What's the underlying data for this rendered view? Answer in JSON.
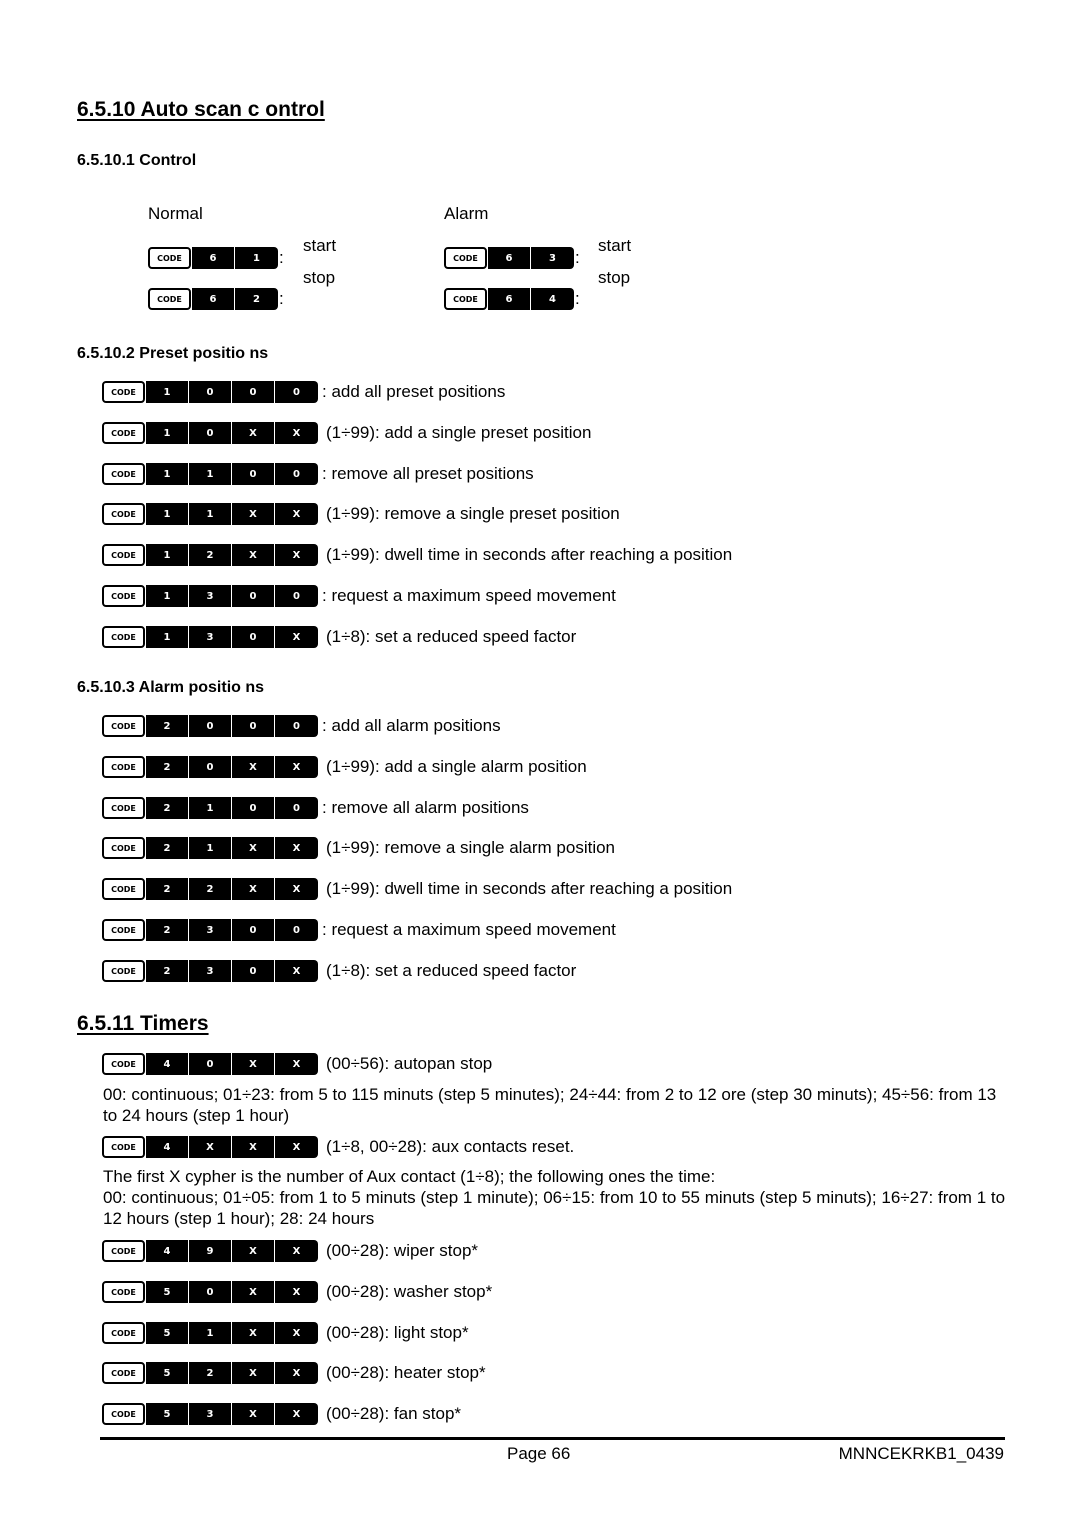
{
  "section_auto_scan": {
    "title": "6.5.10 Auto scan c ontrol",
    "control": {
      "title": "6.5.10.1 Control",
      "normal_label": "Normal",
      "alarm_label": "Alarm",
      "start_label": "start",
      "stop_label": "stop",
      "normal_start_keys": [
        "CODE",
        "6",
        "1"
      ],
      "normal_stop_keys": [
        "CODE",
        "6",
        "2"
      ],
      "alarm_start_keys": [
        "CODE",
        "6",
        "3"
      ],
      "alarm_stop_keys": [
        "CODE",
        "6",
        "4"
      ],
      "colon": ":"
    },
    "preset": {
      "title": "6.5.10.2 Preset positio ns",
      "rows": [
        {
          "keys": [
            "CODE",
            "1",
            "0",
            "0",
            "0"
          ],
          "text": ": add all preset positions"
        },
        {
          "keys": [
            "CODE",
            "1",
            "0",
            "X",
            "X"
          ],
          "text": "(1÷99): add a single preset position"
        },
        {
          "keys": [
            "CODE",
            "1",
            "1",
            "0",
            "0"
          ],
          "text": ": remove all preset positions"
        },
        {
          "keys": [
            "CODE",
            "1",
            "1",
            "X",
            "X"
          ],
          "text": "(1÷99): remove a single preset position"
        },
        {
          "keys": [
            "CODE",
            "1",
            "2",
            "X",
            "X"
          ],
          "text": "(1÷99): dwell time in seconds after reaching a position"
        },
        {
          "keys": [
            "CODE",
            "1",
            "3",
            "0",
            "0"
          ],
          "text": ": request a maximum speed movement"
        },
        {
          "keys": [
            "CODE",
            "1",
            "3",
            "0",
            "X"
          ],
          "text": "(1÷8): set a reduced speed factor"
        }
      ]
    },
    "alarm": {
      "title": "6.5.10.3 Alarm positio ns",
      "rows": [
        {
          "keys": [
            "CODE",
            "2",
            "0",
            "0",
            "0"
          ],
          "text": ": add all alarm positions"
        },
        {
          "keys": [
            "CODE",
            "2",
            "0",
            "X",
            "X"
          ],
          "text": "(1÷99): add a single alarm position"
        },
        {
          "keys": [
            "CODE",
            "2",
            "1",
            "0",
            "0"
          ],
          "text": ": remove all alarm positions"
        },
        {
          "keys": [
            "CODE",
            "2",
            "1",
            "X",
            "X"
          ],
          "text": "(1÷99): remove a single alarm position"
        },
        {
          "keys": [
            "CODE",
            "2",
            "2",
            "X",
            "X"
          ],
          "text": "(1÷99): dwell time in seconds after reaching a position"
        },
        {
          "keys": [
            "CODE",
            "2",
            "3",
            "0",
            "0"
          ],
          "text": ": request a maximum speed movement"
        },
        {
          "keys": [
            "CODE",
            "2",
            "3",
            "0",
            "X"
          ],
          "text": "(1÷8): set a reduced speed factor"
        }
      ]
    }
  },
  "section_timers": {
    "title": "6.5.11 Timers",
    "autopan": {
      "keys": [
        "CODE",
        "4",
        "0",
        "X",
        "X"
      ],
      "text": "(00÷56): autopan stop"
    },
    "autopan_desc": "00: continuous; 01÷23: from 5 to 115 minuts (step 5 minutes); 24÷44: from 2 to 12 ore (step 30 minuts); 45÷56: from 13 to 24 hours (step 1 hour)",
    "aux": {
      "keys": [
        "CODE",
        "4",
        "X",
        "X",
        "X"
      ],
      "text": "(1÷8, 00÷28): aux contacts reset."
    },
    "aux_desc_1": "The first X cypher is the number of Aux contact (1÷8); the following ones the time:",
    "aux_desc_2": "00: continuous; 01÷05: from 1 to 5 minuts (step 1 minute); 06÷15: from 10 to 55 minuts (step 5 minuts); 16÷27: from 1 to 12 hours (step 1 hour); 28: 24 hours",
    "rows": [
      {
        "keys": [
          "CODE",
          "4",
          "9",
          "X",
          "X"
        ],
        "text": "(00÷28): wiper stop*"
      },
      {
        "keys": [
          "CODE",
          "5",
          "0",
          "X",
          "X"
        ],
        "text": "(00÷28): washer stop*"
      },
      {
        "keys": [
          "CODE",
          "5",
          "1",
          "X",
          "X"
        ],
        "text": "(00÷28): light stop*"
      },
      {
        "keys": [
          "CODE",
          "5",
          "2",
          "X",
          "X"
        ],
        "text": "(00÷28): heater stop*"
      },
      {
        "keys": [
          "CODE",
          "5",
          "3",
          "X",
          "X"
        ],
        "text": "(00÷28): fan stop*"
      }
    ]
  },
  "footer": {
    "page": "Page 66",
    "doc_code": "MNNCEKRKB1_0439"
  }
}
